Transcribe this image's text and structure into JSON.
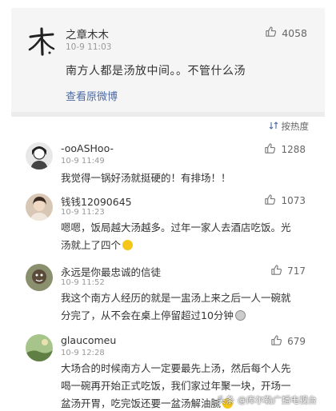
{
  "original_post": {
    "username": "之章木木",
    "time": "10-9 11:03",
    "text": "南方人都是汤放中间。。不管什么汤",
    "view_link": "查看原微博",
    "likes": "4058"
  },
  "sort_label": "按热度",
  "comments": [
    {
      "username": "-ooASHoo-",
      "time": "10-9 11:49",
      "text": "我觉得一锅好汤就挺硬的！有排场！！",
      "likes": "1288"
    },
    {
      "username": "钱钱12090645",
      "time": "10-9 11:23",
      "text_line1": "嗯嗯，饭局越大汤越多。过年一家人去酒店吃饭。光",
      "text_line2": "汤就上了四个",
      "likes": "1073"
    },
    {
      "username": "永远是你最忠诚的信徒",
      "time": "10-9 11:52",
      "text_line1": "我这个南方人经历的就是一盅汤上来之后一人一碗就",
      "text_line2": "分完了，从不会在桌上停留超过10分钟",
      "likes": "717"
    },
    {
      "username": "glaucomeu",
      "time": "10-9 12:28",
      "text_line1": "大场合的时候南方人一定要最先上汤，然后每个人先",
      "text_line2": "喝一碗再开始正式吃饭，我们家过年聚一块，开场一",
      "text_line3": "盆汤开胃，吃完饭还要一盆汤解油腻",
      "likes": "679"
    }
  ],
  "watermark": {
    "prefix": "头条",
    "text": "@库尔勒广播电视台"
  }
}
